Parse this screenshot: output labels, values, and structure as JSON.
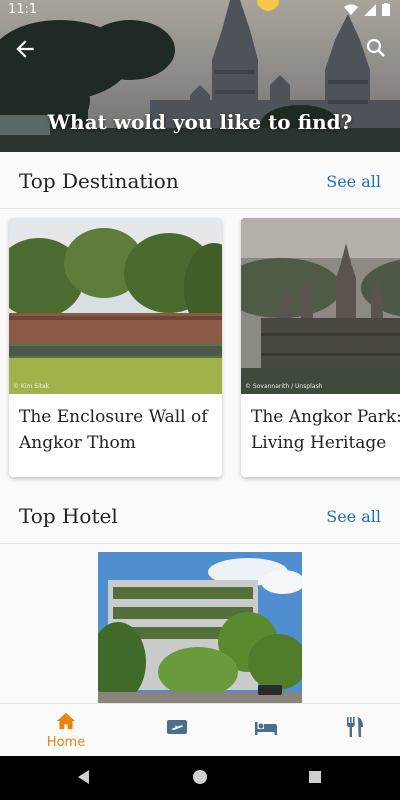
{
  "status_bar": {
    "time": "11:1"
  },
  "hero": {
    "title": "What wold you like to find?"
  },
  "top_destination": {
    "title": "Top Destination",
    "see_all": "See all",
    "cards": [
      {
        "caption": "The Enclosure Wall of Angkor Thom",
        "credit": "© Kim Sitak"
      },
      {
        "caption": "The Angkor Park: A Living Heritage",
        "credit": "© Sovannarith / Unsplash"
      }
    ]
  },
  "top_hotel": {
    "title": "Top Hotel",
    "see_all": "See all"
  },
  "bottom_nav": {
    "active_color": "#e8850e",
    "inactive_color": "#4a6f8a",
    "items": [
      {
        "icon": "home-icon",
        "label": "Home"
      },
      {
        "icon": "flight-ticket-icon",
        "label": ""
      },
      {
        "icon": "bed-icon",
        "label": ""
      },
      {
        "icon": "restaurant-icon",
        "label": ""
      }
    ]
  }
}
